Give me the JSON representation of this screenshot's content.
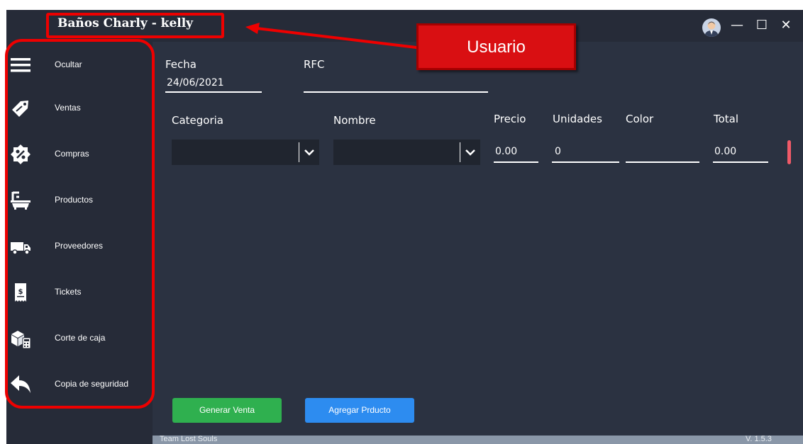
{
  "window": {
    "title": "Baños Charly - kelly",
    "minimize_glyph": "—",
    "maximize_glyph": "☐",
    "close_glyph": "✕"
  },
  "sidebar": {
    "items": [
      {
        "label": "Ocultar",
        "icon": "hamburger-menu-icon"
      },
      {
        "label": "Ventas",
        "icon": "sale-tag-icon"
      },
      {
        "label": "Compras",
        "icon": "percent-badge-icon"
      },
      {
        "label": "Productos",
        "icon": "bathtub-icon"
      },
      {
        "label": "Proveedores",
        "icon": "delivery-truck-icon"
      },
      {
        "label": "Tickets",
        "icon": "receipt-icon"
      },
      {
        "label": "Corte de caja",
        "icon": "boxes-calculator-icon"
      },
      {
        "label": "Copia de seguridad",
        "icon": "back-arrow-icon"
      }
    ]
  },
  "form": {
    "fecha_label": "Fecha",
    "fecha_value": "24/06/2021",
    "rfc_label": "RFC",
    "rfc_value": "",
    "categoria_label": "Categoria",
    "nombre_label": "Nombre",
    "precio_label": "Precio",
    "precio_value": "0.00",
    "unidades_label": "Unidades",
    "unidades_value": "0",
    "color_label": "Color",
    "color_value": "",
    "total_label": "Total",
    "total_value": "0.00"
  },
  "buttons": {
    "generar_venta": "Generar Venta",
    "agregar_producto": "Agregar Prducto"
  },
  "status": {
    "team": "Team Lost Souls",
    "version": "V. 1.5.3"
  },
  "annotation": {
    "callout_label": "Usuario"
  },
  "colors": {
    "background": "#2b3241",
    "sidebar": "#262b38",
    "generar_venta": "#2fb04f",
    "agregar_producto": "#2d8cf0",
    "annotation_red": "#ee0000",
    "remove_marker": "#f05a68"
  }
}
